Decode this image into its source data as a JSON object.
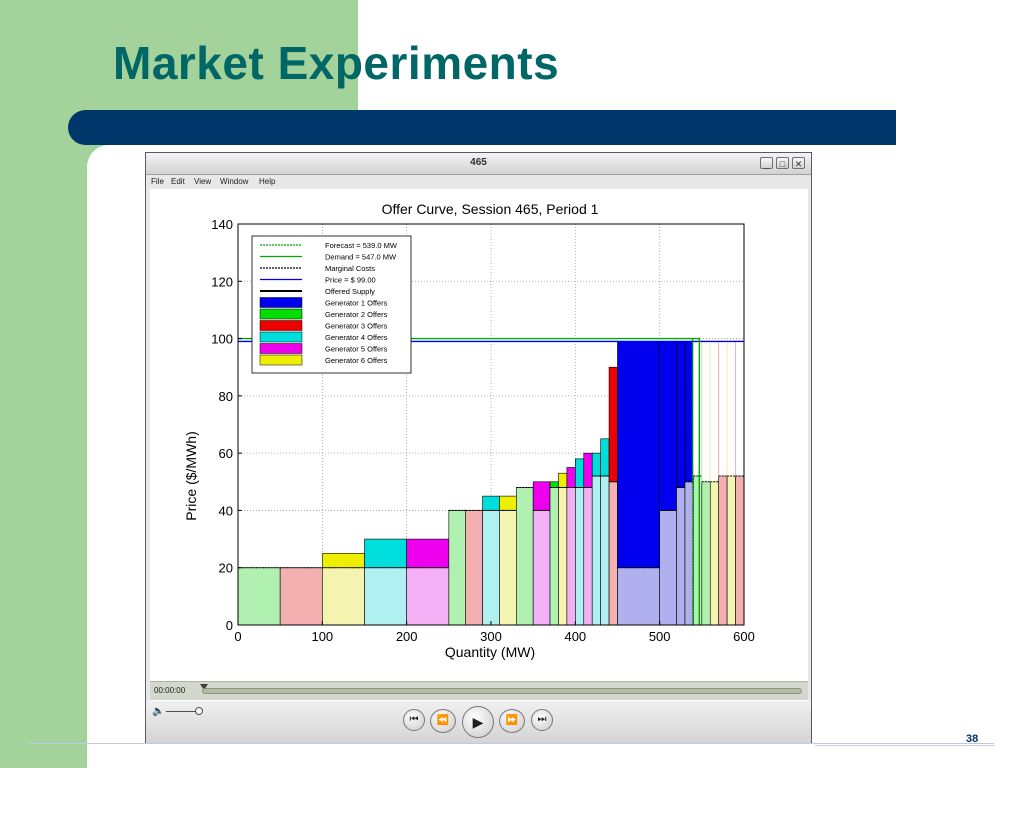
{
  "slide": {
    "title": "Market Experiments",
    "page_number": "38"
  },
  "window": {
    "title": "465",
    "buttons": {
      "minimize": "_",
      "maximize": "□",
      "close": "✕"
    },
    "menu": [
      "File",
      "Edit",
      "View",
      "Window",
      "Help"
    ]
  },
  "player": {
    "time": "00:00:00",
    "volume_icon": "speaker-icon",
    "buttons": {
      "skip_back": "⏮",
      "rewind": "⏪",
      "play": "▶",
      "fast_forward": "⏩",
      "skip_forward": "⏭"
    }
  },
  "colors": {
    "title": "#006666",
    "left_band": "#a3d29a",
    "title_bar": "#00376b",
    "gen1": "#0000ee",
    "gen2": "#00dd00",
    "gen3": "#ee0000",
    "gen4": "#00dddd",
    "gen5": "#ee00ee",
    "gen6": "#eeee00"
  },
  "chart_data": {
    "type": "bar",
    "title": "Offer Curve, Session 465, Period 1",
    "xlabel": "Quantity (MW)",
    "ylabel": "Price ($/MWh)",
    "xlim": [
      0,
      600
    ],
    "ylim": [
      0,
      140
    ],
    "xticks": [
      0,
      100,
      200,
      300,
      400,
      500,
      600
    ],
    "yticks": [
      0,
      20,
      40,
      60,
      80,
      100,
      120,
      140
    ],
    "grid": true,
    "legend_position": "top-left",
    "legend": [
      {
        "label": "Forecast = 539.0 MW",
        "style": "dotted-line",
        "color": "#00aa00"
      },
      {
        "label": "Demand = 547.0 MW",
        "style": "line",
        "color": "#00aa00"
      },
      {
        "label": "Marginal Costs",
        "style": "dotted-line",
        "color": "#000000"
      },
      {
        "label": "Price = $ 99.00",
        "style": "line",
        "color": "#0000ee"
      },
      {
        "label": "Offered Supply",
        "style": "thick-line",
        "color": "#000000"
      },
      {
        "label": "Generator 1 Offers",
        "style": "patch",
        "color": "#0000ee"
      },
      {
        "label": "Generator 2 Offers",
        "style": "patch",
        "color": "#00dd00"
      },
      {
        "label": "Generator 3 Offers",
        "style": "patch",
        "color": "#ee0000"
      },
      {
        "label": "Generator 4 Offers",
        "style": "patch",
        "color": "#00dddd"
      },
      {
        "label": "Generator 5 Offers",
        "style": "patch",
        "color": "#ee00ee"
      },
      {
        "label": "Generator 6 Offers",
        "style": "patch",
        "color": "#eeee00"
      }
    ],
    "price": 99,
    "forecast_mw": 539,
    "demand_mw": 547,
    "demand_price": 100,
    "offers": [
      {
        "x0": 0,
        "x1": 50,
        "cost": 20,
        "price": 20,
        "gen": 2
      },
      {
        "x0": 50,
        "x1": 100,
        "cost": 20,
        "price": 20,
        "gen": 3
      },
      {
        "x0": 100,
        "x1": 150,
        "cost": 20,
        "price": 25,
        "gen": 6
      },
      {
        "x0": 150,
        "x1": 200,
        "cost": 20,
        "price": 30,
        "gen": 4
      },
      {
        "x0": 200,
        "x1": 250,
        "cost": 20,
        "price": 30,
        "gen": 5
      },
      {
        "x0": 250,
        "x1": 270,
        "cost": 40,
        "price": 40,
        "gen": 2
      },
      {
        "x0": 270,
        "x1": 290,
        "cost": 40,
        "price": 40,
        "gen": 3
      },
      {
        "x0": 290,
        "x1": 310,
        "cost": 40,
        "price": 45,
        "gen": 4
      },
      {
        "x0": 310,
        "x1": 330,
        "cost": 40,
        "price": 45,
        "gen": 6
      },
      {
        "x0": 330,
        "x1": 350,
        "cost": 48,
        "price": 48,
        "gen": 2
      },
      {
        "x0": 350,
        "x1": 370,
        "cost": 40,
        "price": 50,
        "gen": 5
      },
      {
        "x0": 370,
        "x1": 380,
        "cost": 48,
        "price": 50,
        "gen": 2
      },
      {
        "x0": 380,
        "x1": 390,
        "cost": 48,
        "price": 53,
        "gen": 6
      },
      {
        "x0": 390,
        "x1": 400,
        "cost": 48,
        "price": 55,
        "gen": 5
      },
      {
        "x0": 400,
        "x1": 410,
        "cost": 48,
        "price": 58,
        "gen": 4
      },
      {
        "x0": 410,
        "x1": 420,
        "cost": 48,
        "price": 60,
        "gen": 5
      },
      {
        "x0": 420,
        "x1": 430,
        "cost": 52,
        "price": 60,
        "gen": 4
      },
      {
        "x0": 430,
        "x1": 440,
        "cost": 52,
        "price": 65,
        "gen": 4
      },
      {
        "x0": 440,
        "x1": 450,
        "cost": 50,
        "price": 90,
        "gen": 3
      },
      {
        "x0": 450,
        "x1": 500,
        "cost": 20,
        "price": 99,
        "gen": 1
      },
      {
        "x0": 500,
        "x1": 520,
        "cost": 40,
        "price": 99,
        "gen": 1
      },
      {
        "x0": 520,
        "x1": 530,
        "cost": 48,
        "price": 99,
        "gen": 1
      },
      {
        "x0": 530,
        "x1": 540,
        "cost": 50,
        "price": 99,
        "gen": 1
      },
      {
        "x0": 540,
        "x1": 550,
        "cost": 52,
        "price": 99,
        "gen": 2
      },
      {
        "x0": 550,
        "x1": 560,
        "cost": 50,
        "price": 99,
        "gen": 2
      },
      {
        "x0": 560,
        "x1": 570,
        "cost": 50,
        "price": 99,
        "gen": 6
      },
      {
        "x0": 570,
        "x1": 580,
        "cost": 52,
        "price": 99,
        "gen": 3
      },
      {
        "x0": 580,
        "x1": 590,
        "cost": 52,
        "price": 99,
        "gen": 6
      },
      {
        "x0": 590,
        "x1": 600,
        "cost": 52,
        "price": 99,
        "gen": 3
      }
    ]
  }
}
